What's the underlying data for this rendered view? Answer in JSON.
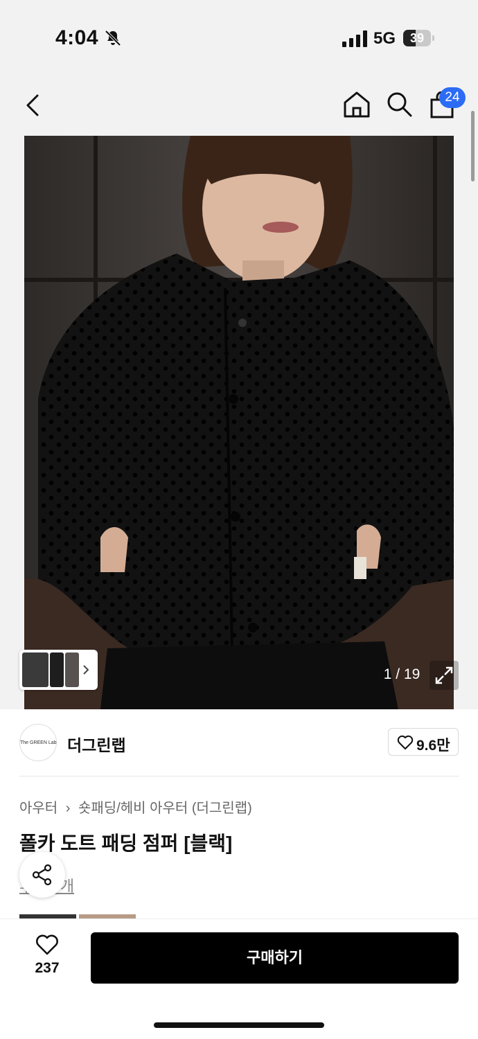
{
  "status": {
    "time": "4:04",
    "network": "5G",
    "battery": "39"
  },
  "nav": {
    "cart_count": "24"
  },
  "gallery": {
    "counter": "1 / 19"
  },
  "brand": {
    "logo_text": "The GREEN Lab",
    "name": "더그린랩",
    "likes": "9.6만"
  },
  "product": {
    "breadcrumb": [
      "아우터",
      "숏패딩/헤비 아우터 (더그린랩)"
    ],
    "title": "폴카 도트 패딩 점퍼 [블랙]",
    "review_link": "후기 0개"
  },
  "bottom": {
    "wish_count": "237",
    "buy_label": "구매하기"
  },
  "colors": {
    "accent": "#2c6cf5",
    "primary_button": "#000000"
  }
}
